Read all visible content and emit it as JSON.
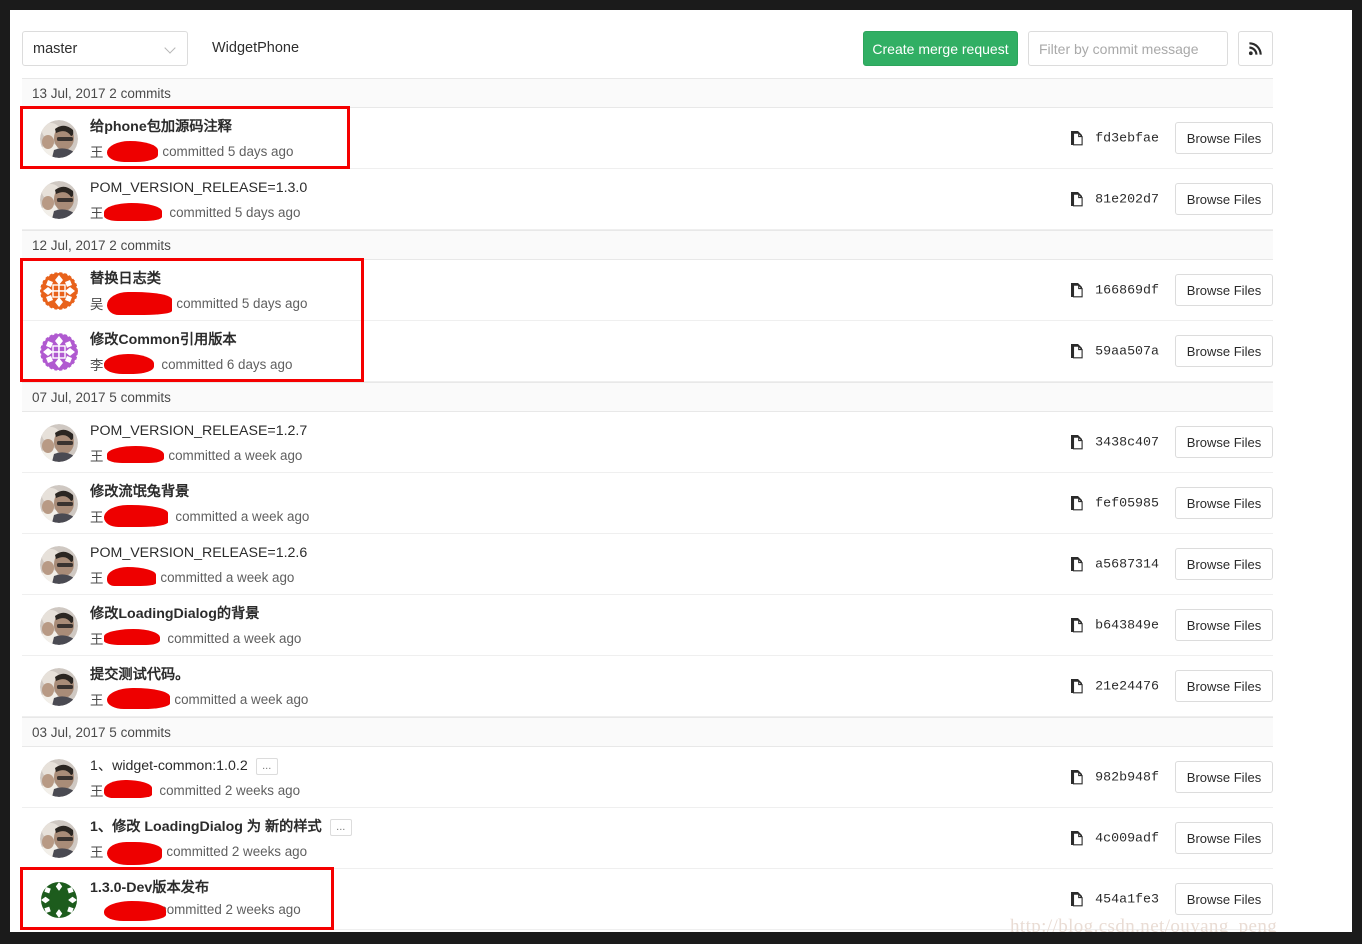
{
  "toolbar": {
    "branch": "master",
    "branch_icon": "chevron-down-icon",
    "project_name": "WidgetPhone",
    "create_merge_request_label": "Create merge request",
    "filter_placeholder": "Filter by commit message",
    "filter_value": "",
    "rss_icon": "rss-icon"
  },
  "colors": {
    "primary_button": "#31af64",
    "annotation": "#f50000",
    "redaction": "#ee0000",
    "border": "#dcdcdc",
    "header_band": "#fafafa"
  },
  "browse_files_label": "Browse Files",
  "groups": [
    {
      "header": "13 Jul, 2017 2 commits",
      "commits": [
        {
          "title": "给phone包加源码注释",
          "bold": true,
          "ellipsis": false,
          "author": "王",
          "meta": "committed 5 days ago",
          "hash": "fd3ebfae",
          "avatar": "photo",
          "annotated": true
        },
        {
          "title": "POM_VERSION_RELEASE=1.3.0",
          "bold": false,
          "ellipsis": false,
          "author": "王",
          "meta": "committed 5 days ago",
          "hash": "81e202d7",
          "avatar": "photo",
          "annotated": false
        }
      ]
    },
    {
      "header": "12 Jul, 2017 2 commits",
      "commits": [
        {
          "title": "替换日志类",
          "bold": true,
          "ellipsis": false,
          "author": "吴",
          "meta": "committed 5 days ago",
          "hash": "166869df",
          "avatar": "identicon-orange",
          "annotated": true
        },
        {
          "title": "修改Common引用版本",
          "bold": true,
          "ellipsis": false,
          "author": "李",
          "meta": "committed 6 days ago",
          "hash": "59aa507a",
          "avatar": "identicon-purple",
          "annotated": true
        }
      ]
    },
    {
      "header": "07 Jul, 2017 5 commits",
      "commits": [
        {
          "title": "POM_VERSION_RELEASE=1.2.7",
          "bold": false,
          "ellipsis": false,
          "author": "王",
          "meta": "committed a week ago",
          "hash": "3438c407",
          "avatar": "photo",
          "annotated": false
        },
        {
          "title": "修改流氓兔背景",
          "bold": true,
          "ellipsis": false,
          "author": "王",
          "meta": "committed a week ago",
          "hash": "fef05985",
          "avatar": "photo",
          "annotated": false
        },
        {
          "title": "POM_VERSION_RELEASE=1.2.6",
          "bold": false,
          "ellipsis": false,
          "author": "王",
          "meta": "committed a week ago",
          "hash": "a5687314",
          "avatar": "photo",
          "annotated": false
        },
        {
          "title": "修改LoadingDialog的背景",
          "bold": true,
          "ellipsis": false,
          "author": "王",
          "meta": "committed a week ago",
          "hash": "b643849e",
          "avatar": "photo",
          "annotated": false
        },
        {
          "title": "提交测试代码。",
          "bold": true,
          "ellipsis": false,
          "author": "王",
          "meta": "committed a week ago",
          "hash": "21e24476",
          "avatar": "photo",
          "annotated": false
        }
      ]
    },
    {
      "header": "03 Jul, 2017 5 commits",
      "commits": [
        {
          "title": "1、widget-common:1.0.2",
          "bold": false,
          "ellipsis": true,
          "ellipsis_label": "...",
          "author": "王",
          "meta": "committed 2 weeks ago",
          "hash": "982b948f",
          "avatar": "photo",
          "annotated": false
        },
        {
          "title": "1、修改 LoadingDialog 为 新的样式",
          "bold": true,
          "ellipsis": true,
          "ellipsis_label": "...",
          "author": "王",
          "meta": "committed 2 weeks ago",
          "hash": "4c009adf",
          "avatar": "photo",
          "annotated": false
        },
        {
          "title": "1.3.0-Dev版本发布",
          "bold": true,
          "ellipsis": false,
          "author": "",
          "meta": "committed 2 weeks ago",
          "hash": "454a1fe3",
          "avatar": "identicon-green",
          "annotated": true
        }
      ]
    }
  ],
  "watermark": "http://blog.csdn.net/ouyang_peng"
}
